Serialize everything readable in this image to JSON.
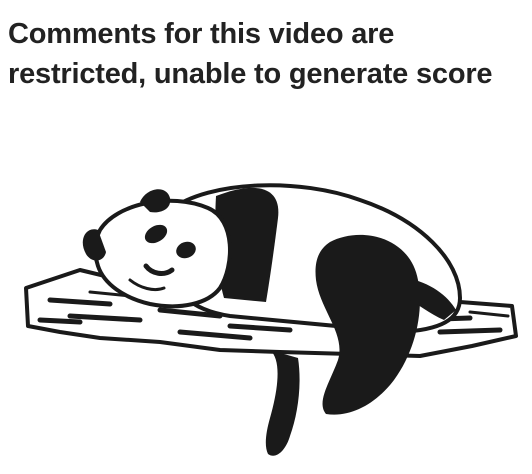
{
  "message": {
    "line1": "Comments for this video are",
    "line2": "restricted, unable to generate score"
  },
  "illustration": {
    "icon": "sleeping-panda-icon",
    "ink_color": "#1a1a1a",
    "paper_color": "#ffffff"
  }
}
